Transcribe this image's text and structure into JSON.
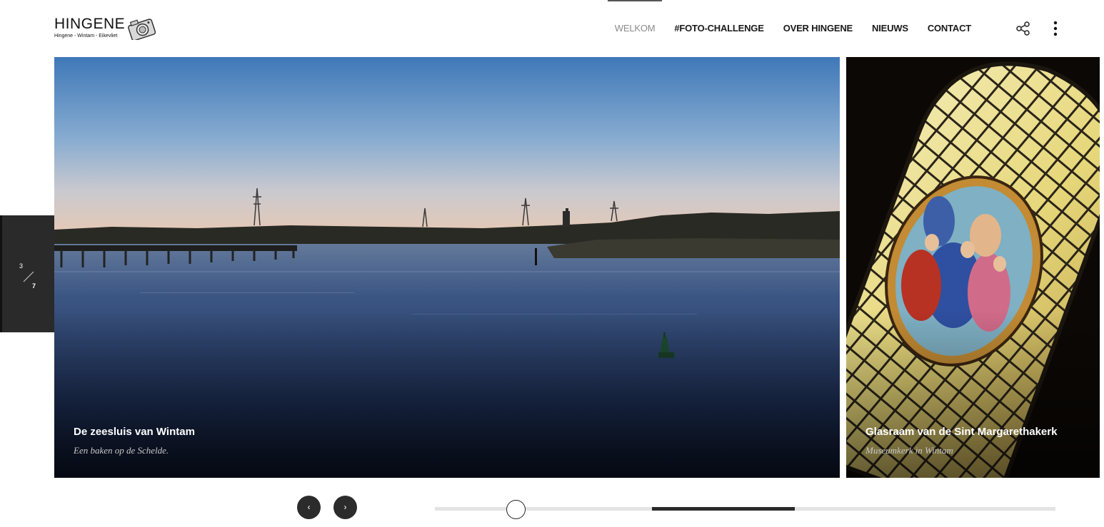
{
  "header": {
    "logo_title": "HINGENE",
    "logo_subtitle": "Hingene - Wintam - Eikevliet",
    "share_icon": "share-icon",
    "more_icon": "more-vertical-icon"
  },
  "nav": {
    "items": [
      {
        "label": "WELKOM",
        "active": true
      },
      {
        "label": "#FOTO-CHALLENGE",
        "active": false
      },
      {
        "label": "OVER HINGENE",
        "active": false
      },
      {
        "label": "NIEUWS",
        "active": false
      },
      {
        "label": "CONTACT",
        "active": false
      }
    ]
  },
  "counter": {
    "current": "3",
    "total": "7"
  },
  "slides": [
    {
      "title": "De zeesluis van Wintam",
      "subtitle": "Een baken op de Schelde."
    },
    {
      "title": "Glasraam van de Sint Margarethakerk",
      "subtitle": "Museumkerk in Wintam"
    }
  ],
  "controls": {
    "prev_label": "‹",
    "next_label": "›",
    "progress_segment_start": 0.35,
    "progress_segment_end": 0.58,
    "knob_position": 0.13
  },
  "colors": {
    "accent_dark": "#2a2a2a",
    "nav_active": "#8a8a8a",
    "track": "#e3e3e3"
  }
}
